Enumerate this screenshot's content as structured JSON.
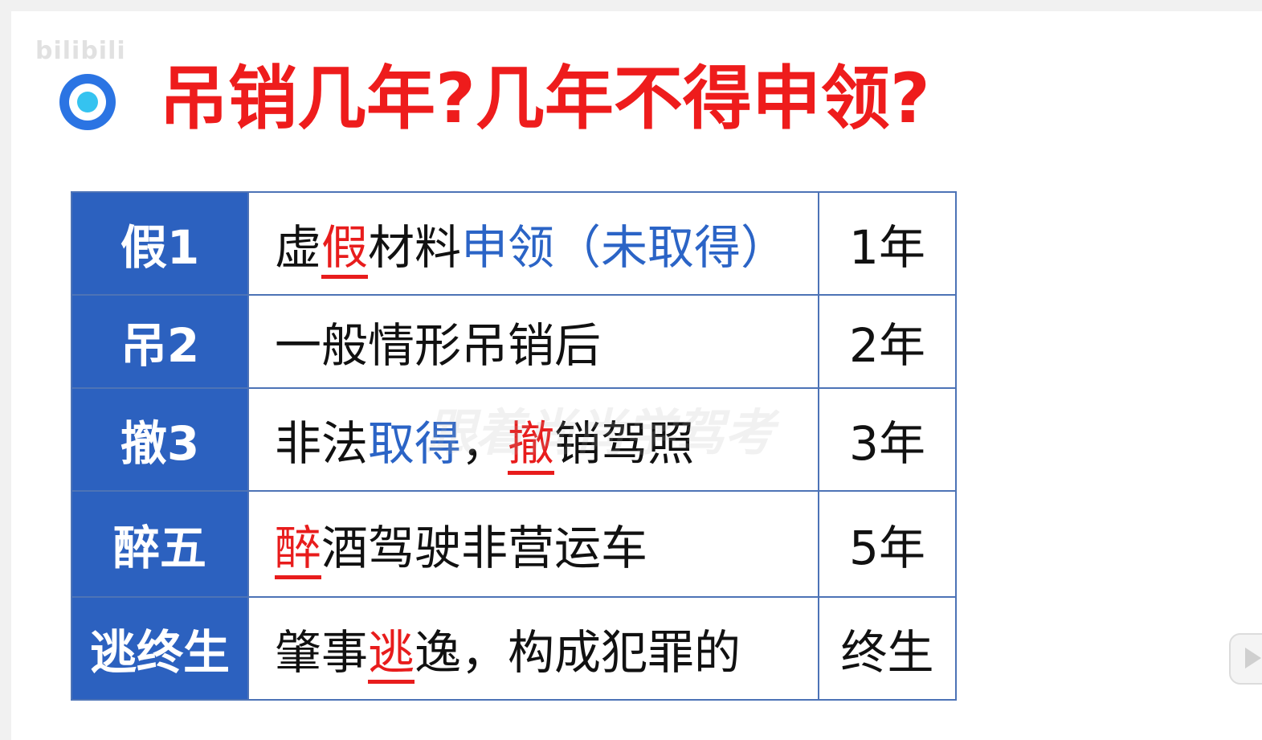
{
  "watermark_logo": "bilibili",
  "title": "吊销几年?几年不得申领?",
  "rows": [
    {
      "key": "假1",
      "desc": [
        {
          "t": "虚",
          "c": ""
        },
        {
          "t": "假",
          "c": "red ul"
        },
        {
          "t": "材料",
          "c": ""
        },
        {
          "t": "申领（未取得）",
          "c": "blue"
        }
      ],
      "years": "1年"
    },
    {
      "key": "吊2",
      "desc": [
        {
          "t": "一般情形吊销后",
          "c": ""
        }
      ],
      "years": "2年"
    },
    {
      "key": "撤3",
      "desc": [
        {
          "t": "非法",
          "c": ""
        },
        {
          "t": "取得",
          "c": "blue"
        },
        {
          "t": "，",
          "c": ""
        },
        {
          "t": "撤",
          "c": "red ul"
        },
        {
          "t": "销驾照",
          "c": ""
        }
      ],
      "years": "3年"
    },
    {
      "key": "醉五",
      "desc": [
        {
          "t": "醉",
          "c": "red ul"
        },
        {
          "t": "酒驾驶非营运车",
          "c": ""
        }
      ],
      "years": "5年"
    },
    {
      "key": "逃终生",
      "desc": [
        {
          "t": "肇事",
          "c": ""
        },
        {
          "t": "逃",
          "c": "red ul"
        },
        {
          "t": "逸，构成犯罪的",
          "c": ""
        }
      ],
      "years": "终生"
    }
  ],
  "center_watermark": "跟着尚尚学驾考",
  "colors": {
    "title": "#ee1c1c",
    "key_bg": "#2c61bf",
    "highlight_red": "#e81c1c",
    "highlight_blue": "#2b64c6"
  }
}
